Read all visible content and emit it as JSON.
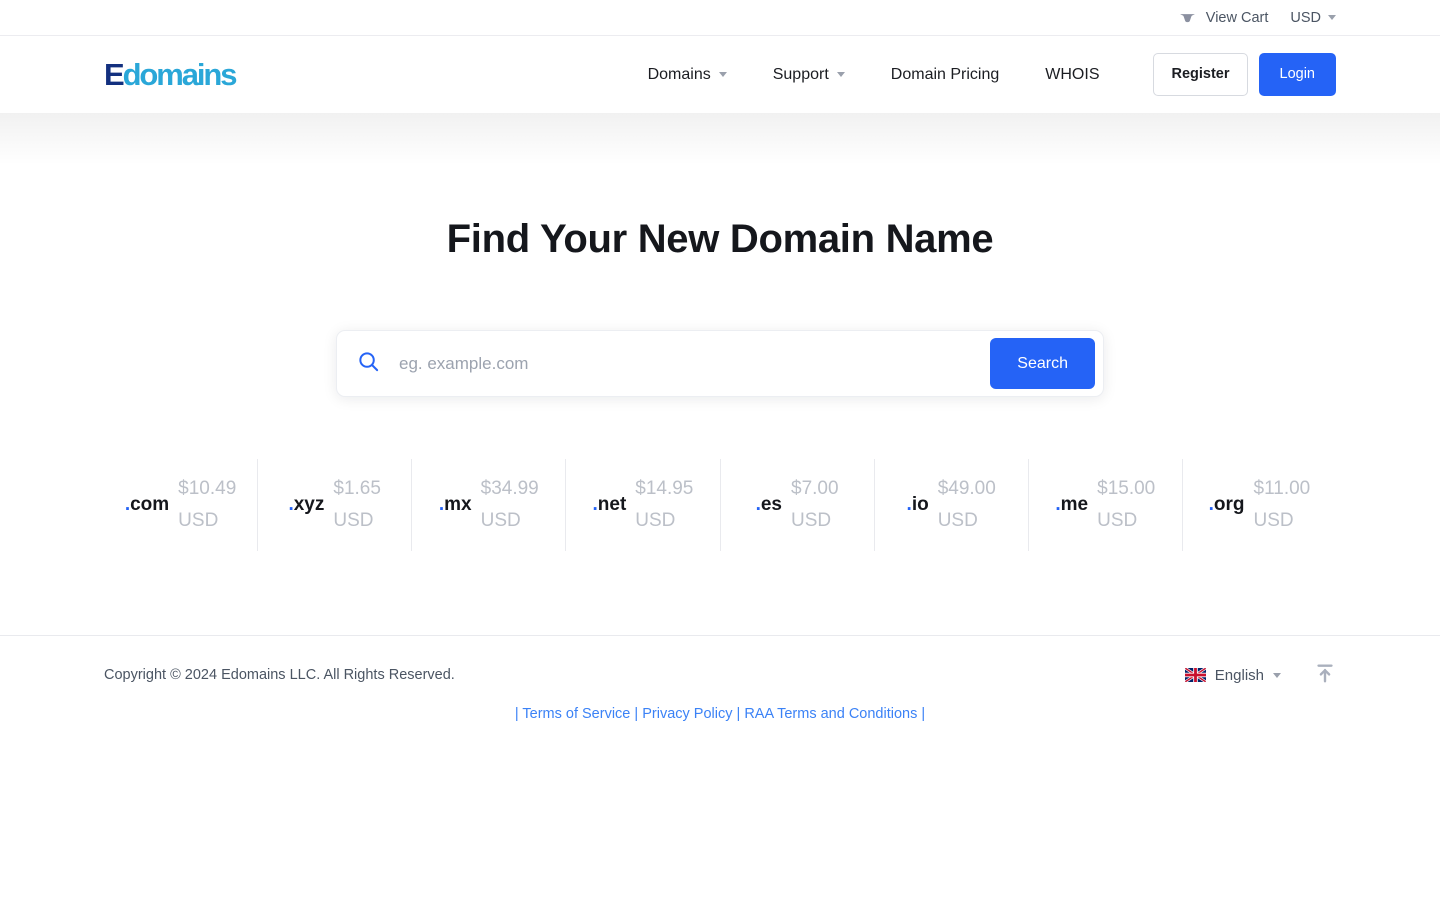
{
  "topbar": {
    "cart_icon": "shopping-basket-icon",
    "cart_label": "View Cart",
    "currency_label": "USD"
  },
  "header": {
    "logo": {
      "prefix": "E",
      "suffix": "domains"
    },
    "nav": [
      {
        "label": "Domains",
        "has_dropdown": true
      },
      {
        "label": "Support",
        "has_dropdown": true
      },
      {
        "label": "Domain Pricing",
        "has_dropdown": false
      },
      {
        "label": "WHOIS",
        "has_dropdown": false
      }
    ],
    "register_label": "Register",
    "login_label": "Login"
  },
  "hero": {
    "title": "Find Your New Domain Name",
    "search": {
      "icon": "search-icon",
      "placeholder": "eg. example.com",
      "value": "",
      "button_label": "Search"
    },
    "tlds": [
      {
        "name": ".com",
        "dot": ".",
        "tld": "com",
        "price": "$10.49",
        "currency": "USD"
      },
      {
        "name": ".xyz",
        "dot": ".",
        "tld": "xyz",
        "price": "$1.65",
        "currency": "USD"
      },
      {
        "name": ".mx",
        "dot": ".",
        "tld": "mx",
        "price": "$34.99",
        "currency": "USD"
      },
      {
        "name": ".net",
        "dot": ".",
        "tld": "net",
        "price": "$14.95",
        "currency": "USD"
      },
      {
        "name": ".es",
        "dot": ".",
        "tld": "es",
        "price": "$7.00",
        "currency": "USD"
      },
      {
        "name": ".io",
        "dot": ".",
        "tld": "io",
        "price": "$49.00",
        "currency": "USD"
      },
      {
        "name": ".me",
        "dot": ".",
        "tld": "me",
        "price": "$15.00",
        "currency": "USD"
      },
      {
        "name": ".org",
        "dot": ".",
        "tld": "org",
        "price": "$11.00",
        "currency": "USD"
      }
    ]
  },
  "footer": {
    "copyright": "Copyright © 2024 Edomains LLC. All Rights Reserved.",
    "language": {
      "flag": "uk-flag-icon",
      "label": "English"
    },
    "to_top_icon": "scroll-to-top-icon",
    "links": {
      "lead": "|",
      "terms": "Terms of Service",
      "sep1": "|",
      "privacy": "Privacy Policy",
      "sep2": "|",
      "raa": "RAA Terms and Conditions",
      "trail": "|"
    }
  },
  "colors": {
    "accent": "#2563f6",
    "logo_dark": "#13307f",
    "logo_light": "#2aa7d8",
    "muted": "#bcc0c8",
    "link": "#3b82f6"
  }
}
